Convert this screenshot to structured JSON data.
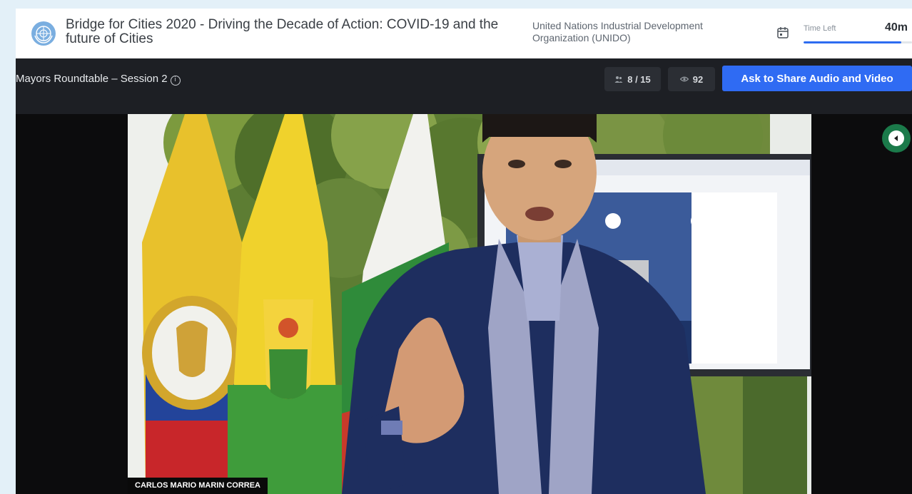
{
  "header": {
    "logo_icon": "un-emblem-icon",
    "event_title": "Bridge for Cities 2020 - Driving the Decade of Action: COVID-19 and the future of Cities",
    "organizer": "United Nations Industrial Development Organization (UNIDO)",
    "calendar_icon": "calendar-icon",
    "time_left_label": "Time Left",
    "time_left_value": "40m",
    "time_left_progress": 0.9
  },
  "session_bar": {
    "session_title": "Mayors Roundtable – Session 2",
    "info_icon": "info-icon",
    "attendees_icon": "people-icon",
    "attendees": "8 / 15",
    "viewers_icon": "eye-icon",
    "viewers": "92",
    "share_button_label": "Ask to Share Audio and Video"
  },
  "video": {
    "speaker_name": "CARLOS MARIO MARIN CORREA",
    "side_toggle_icon": "collapse-arrow-icon"
  },
  "colors": {
    "accent": "#2f6bf3",
    "toggle": "#1b7a4a",
    "session_bar": "#1d1f24"
  }
}
